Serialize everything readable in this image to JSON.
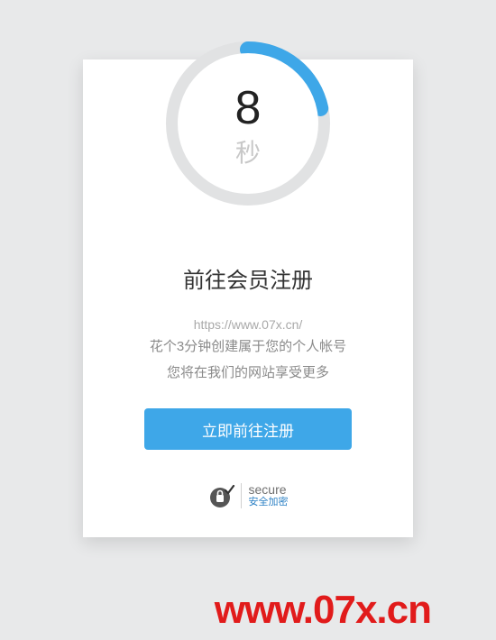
{
  "countdown": {
    "value": "8",
    "unit": "秒",
    "progress_angle": 78
  },
  "card": {
    "title": "前往会员注册",
    "url": "https://www.07x.cn/",
    "desc1": "花个3分钟创建属于您的个人帐号",
    "desc2": "您将在我们的网站享受更多",
    "cta": "立即前往注册"
  },
  "secure": {
    "label": "secure",
    "sub": "安全加密"
  },
  "footer": {
    "watermark": "www.07x.cn"
  },
  "colors": {
    "accent": "#3ea7e8",
    "ring_bg": "#e1e2e3",
    "danger": "#e11b1b"
  }
}
